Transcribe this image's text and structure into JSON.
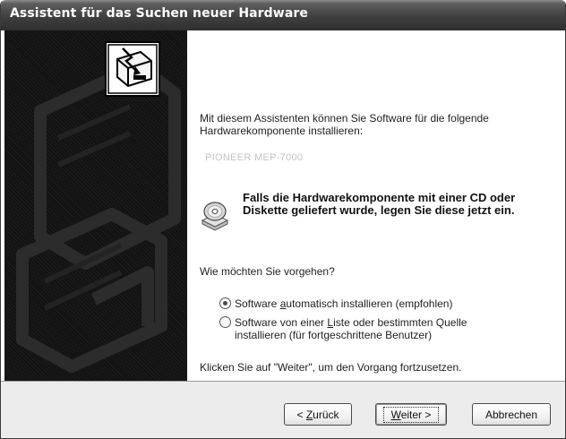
{
  "window": {
    "title": "Assistent für das Suchen neuer Hardware"
  },
  "content": {
    "intro": "Mit diesem Assistenten können Sie Software für die folgende Hardwarekomponente installieren:",
    "device_name": "PIONEER MEP-7000",
    "cd_note": "Falls die Hardwarekomponente mit einer CD oder Diskette geliefert wurde, legen Sie diese jetzt ein.",
    "question": "Wie möchten Sie vorgehen?",
    "options": [
      {
        "pre": "Software ",
        "accel": "a",
        "post": "utomatisch installieren (empfohlen)",
        "selected": true
      },
      {
        "pre": "Software von einer ",
        "accel": "L",
        "post": "iste oder bestimmten Quelle installieren (für fortgeschrittene Benutzer)",
        "selected": false
      }
    ],
    "hint": "Klicken Sie auf \"Weiter\", um den Vorgang fortzusetzen."
  },
  "buttons": {
    "back": {
      "pre": "< ",
      "accel": "Z",
      "post": "urück"
    },
    "next": {
      "pre": "",
      "accel": "W",
      "post": "eiter >"
    },
    "cancel": "Abbrechen"
  },
  "icons": {
    "wizard": "hardware-wizard-icon",
    "cd": "cd-disk-icon"
  },
  "colors": {
    "titlebar": "#3f3f3f",
    "side_panel": "#121212",
    "bottom_bar": "#ececec",
    "device_text": "#c4c4c4"
  }
}
